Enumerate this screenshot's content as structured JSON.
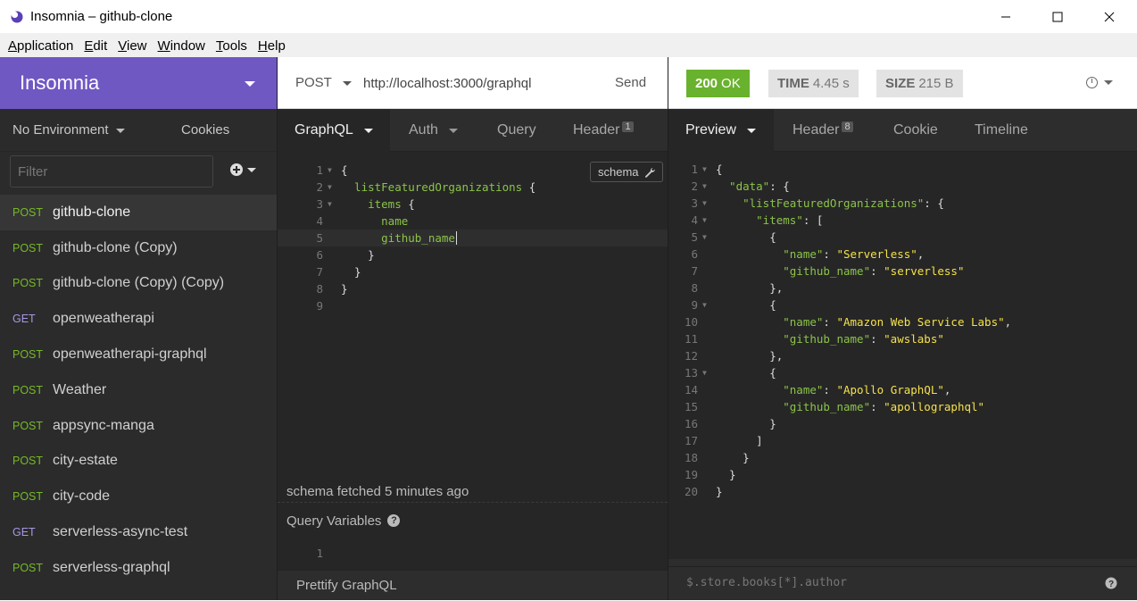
{
  "window": {
    "title": "Insomnia – github-clone"
  },
  "menubar": [
    {
      "u": "A",
      "rest": "pplication"
    },
    {
      "u": "E",
      "rest": "dit"
    },
    {
      "u": "V",
      "rest": "iew"
    },
    {
      "u": "W",
      "rest": "indow"
    },
    {
      "u": "T",
      "rest": "ools"
    },
    {
      "u": "H",
      "rest": "elp"
    }
  ],
  "sidebar": {
    "workspace": "Insomnia",
    "environment": "No Environment",
    "cookies": "Cookies",
    "filter_placeholder": "Filter",
    "requests": [
      {
        "method": "POST",
        "name": "github-clone",
        "active": true
      },
      {
        "method": "POST",
        "name": "github-clone (Copy)"
      },
      {
        "method": "POST",
        "name": "github-clone (Copy) (Copy)"
      },
      {
        "method": "GET",
        "name": "openweatherapi"
      },
      {
        "method": "POST",
        "name": "openweatherapi-graphql"
      },
      {
        "method": "POST",
        "name": "Weather"
      },
      {
        "method": "POST",
        "name": "appsync-manga"
      },
      {
        "method": "POST",
        "name": "city-estate"
      },
      {
        "method": "POST",
        "name": "city-code"
      },
      {
        "method": "GET",
        "name": "serverless-async-test"
      },
      {
        "method": "POST",
        "name": "serverless-graphql"
      }
    ],
    "method_colors": {
      "POST": "#75ba24",
      "GET": "#a797e4"
    }
  },
  "request": {
    "method": "POST",
    "url": "http://localhost:3000/graphql",
    "send": "Send",
    "tabs": [
      {
        "label": "GraphQL",
        "caret": true,
        "active": true
      },
      {
        "label": "Auth",
        "caret": true
      },
      {
        "label": "Query"
      },
      {
        "label": "Header",
        "count": "1"
      }
    ],
    "schema_button": "schema",
    "query_lines": [
      {
        "n": "1",
        "fold": true,
        "parts": [
          [
            "b",
            "{"
          ]
        ]
      },
      {
        "n": "2",
        "fold": true,
        "parts": [
          [
            "f",
            "  listFeaturedOrganizations"
          ],
          [
            "b",
            " {"
          ]
        ]
      },
      {
        "n": "3",
        "fold": true,
        "parts": [
          [
            "f",
            "    items"
          ],
          [
            "b",
            " {"
          ]
        ]
      },
      {
        "n": "4",
        "parts": [
          [
            "f",
            "      name"
          ]
        ]
      },
      {
        "n": "5",
        "parts": [
          [
            "f",
            "      github_name"
          ]
        ],
        "cursor": true
      },
      {
        "n": "6",
        "parts": [
          [
            "b",
            "    }"
          ]
        ]
      },
      {
        "n": "7",
        "parts": [
          [
            "b",
            "  }"
          ]
        ]
      },
      {
        "n": "8",
        "parts": [
          [
            "b",
            "}"
          ]
        ]
      },
      {
        "n": "9",
        "parts": []
      }
    ],
    "schema_status": "schema fetched 5 minutes ago",
    "query_variables_label": "Query Variables",
    "query_variables_lines": [
      "1"
    ],
    "prettify": "Prettify GraphQL"
  },
  "response": {
    "status_code": "200",
    "status_text": "OK",
    "time_label": "TIME",
    "time_value": "4.45 s",
    "size_label": "SIZE",
    "size_value": "215 B",
    "tabs": [
      {
        "label": "Preview",
        "caret": true,
        "active": true
      },
      {
        "label": "Header",
        "count": "8"
      },
      {
        "label": "Cookie"
      },
      {
        "label": "Timeline"
      }
    ],
    "body_lines": [
      {
        "n": "1",
        "fold": true,
        "parts": [
          [
            "b",
            "{"
          ]
        ]
      },
      {
        "n": "2",
        "fold": true,
        "parts": [
          [
            "k",
            "  \"data\""
          ],
          [
            "b",
            ": {"
          ]
        ]
      },
      {
        "n": "3",
        "fold": true,
        "parts": [
          [
            "k",
            "    \"listFeaturedOrganizations\""
          ],
          [
            "b",
            ": {"
          ]
        ]
      },
      {
        "n": "4",
        "fold": true,
        "parts": [
          [
            "k",
            "      \"items\""
          ],
          [
            "b",
            ": ["
          ]
        ]
      },
      {
        "n": "5",
        "fold": true,
        "parts": [
          [
            "b",
            "        {"
          ]
        ]
      },
      {
        "n": "6",
        "parts": [
          [
            "k",
            "          \"name\""
          ],
          [
            "b",
            ": "
          ],
          [
            "s",
            "\"Serverless\""
          ],
          [
            "b",
            ","
          ]
        ]
      },
      {
        "n": "7",
        "parts": [
          [
            "k",
            "          \"github_name\""
          ],
          [
            "b",
            ": "
          ],
          [
            "s",
            "\"serverless\""
          ]
        ]
      },
      {
        "n": "8",
        "parts": [
          [
            "b",
            "        },"
          ]
        ]
      },
      {
        "n": "9",
        "fold": true,
        "parts": [
          [
            "b",
            "        {"
          ]
        ]
      },
      {
        "n": "10",
        "parts": [
          [
            "k",
            "          \"name\""
          ],
          [
            "b",
            ": "
          ],
          [
            "s",
            "\"Amazon Web Service Labs\""
          ],
          [
            "b",
            ","
          ]
        ]
      },
      {
        "n": "11",
        "parts": [
          [
            "k",
            "          \"github_name\""
          ],
          [
            "b",
            ": "
          ],
          [
            "s",
            "\"awslabs\""
          ]
        ]
      },
      {
        "n": "12",
        "parts": [
          [
            "b",
            "        },"
          ]
        ]
      },
      {
        "n": "13",
        "fold": true,
        "parts": [
          [
            "b",
            "        {"
          ]
        ]
      },
      {
        "n": "14",
        "parts": [
          [
            "k",
            "          \"name\""
          ],
          [
            "b",
            ": "
          ],
          [
            "s",
            "\"Apollo GraphQL\""
          ],
          [
            "b",
            ","
          ]
        ]
      },
      {
        "n": "15",
        "parts": [
          [
            "k",
            "          \"github_name\""
          ],
          [
            "b",
            ": "
          ],
          [
            "s",
            "\"apollographql\""
          ]
        ]
      },
      {
        "n": "16",
        "parts": [
          [
            "b",
            "        }"
          ]
        ]
      },
      {
        "n": "17",
        "parts": [
          [
            "b",
            "      ]"
          ]
        ]
      },
      {
        "n": "18",
        "parts": [
          [
            "b",
            "    }"
          ]
        ]
      },
      {
        "n": "19",
        "parts": [
          [
            "b",
            "  }"
          ]
        ]
      },
      {
        "n": "20",
        "parts": [
          [
            "b",
            "}"
          ]
        ]
      }
    ],
    "filter_placeholder": "$.store.books[*].author"
  },
  "icons": {
    "app": "insomnia-logo-icon",
    "minimize": "minimize-icon",
    "maximize": "maximize-icon",
    "close": "close-icon",
    "history": "clock-icon",
    "wrench": "wrench-icon",
    "help": "question-icon",
    "add": "plus-circle-icon"
  }
}
